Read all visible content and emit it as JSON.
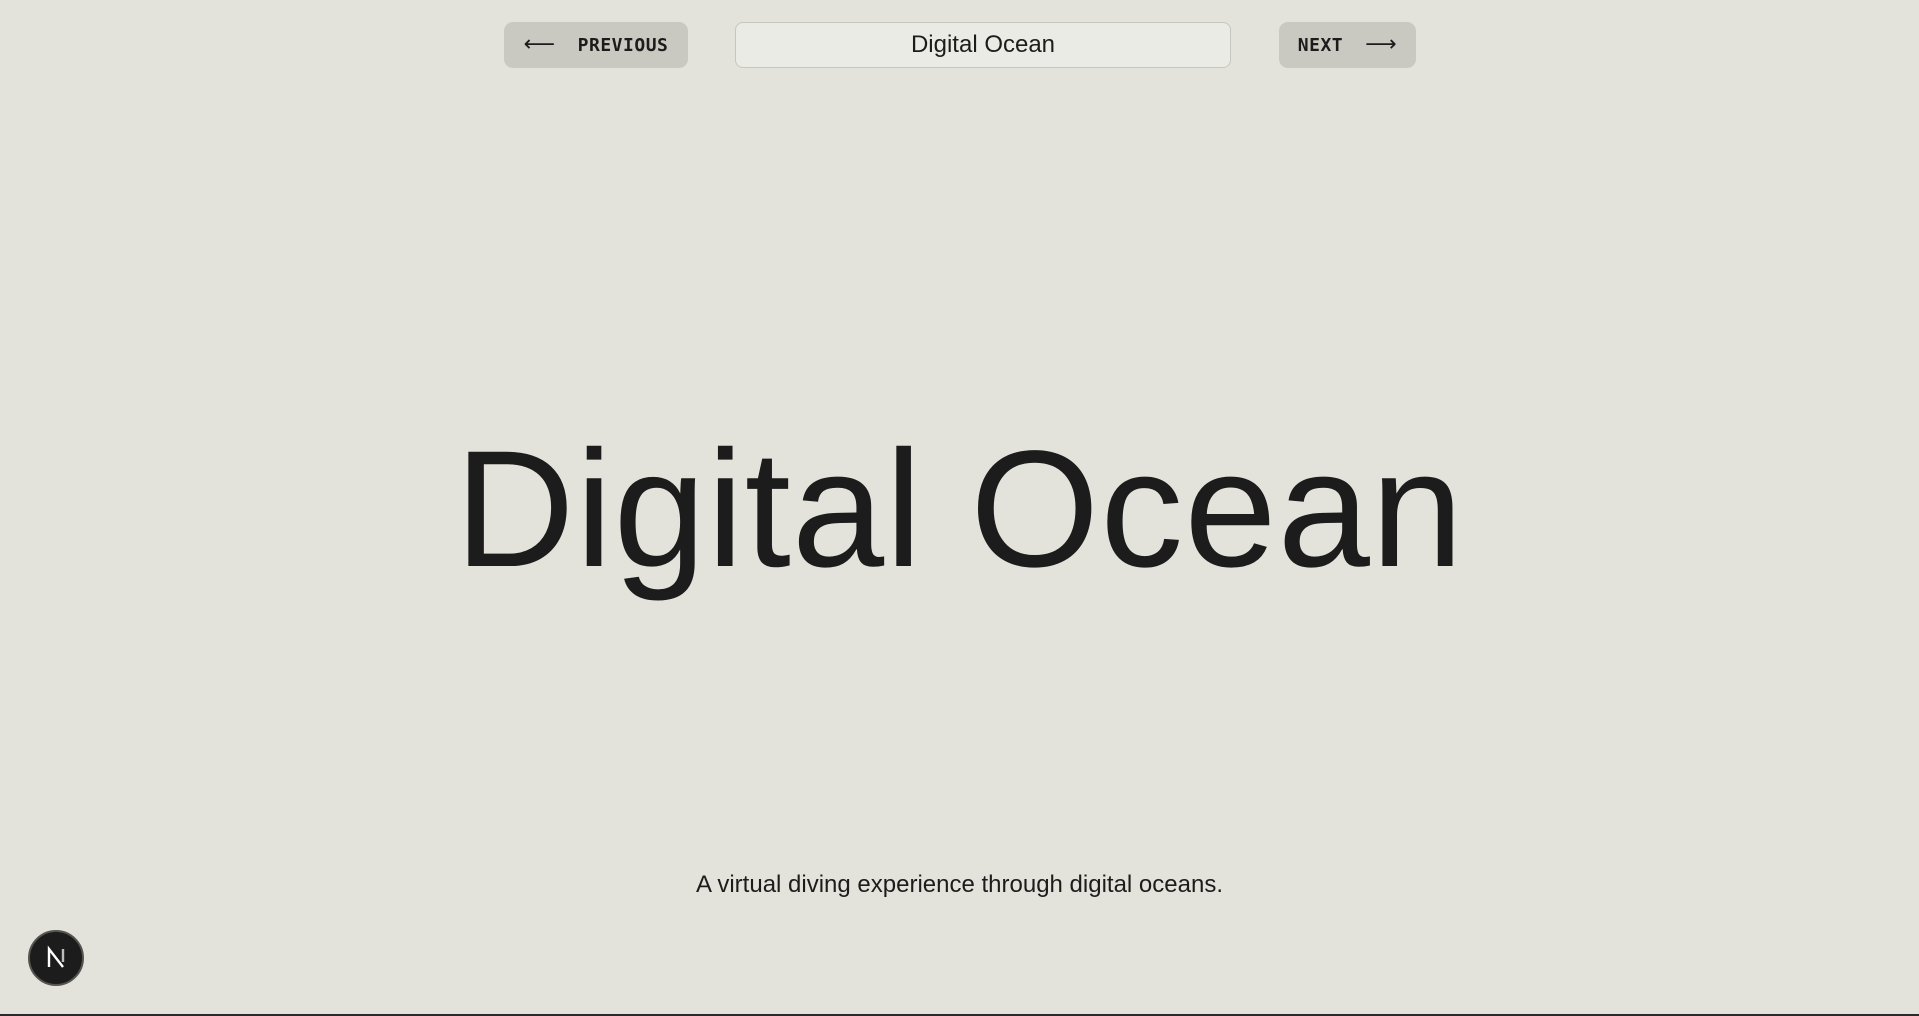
{
  "nav": {
    "previous": {
      "label": "PREVIOUS",
      "icon": "arrow-left-icon",
      "glyph": "⟵"
    },
    "next": {
      "label": "NEXT",
      "icon": "arrow-right-icon",
      "glyph": "⟶"
    },
    "current_title": "Digital Ocean"
  },
  "hero": {
    "title": "Digital Ocean",
    "tagline": "A virtual diving experience through digital oceans."
  },
  "fab": {
    "icon": "nextjs-logo-icon",
    "glyph": "N"
  },
  "colors": {
    "background": "#e3e3dc",
    "button": "#c9c9c1",
    "field": "#ebebe5",
    "text": "#1c1c1c"
  }
}
